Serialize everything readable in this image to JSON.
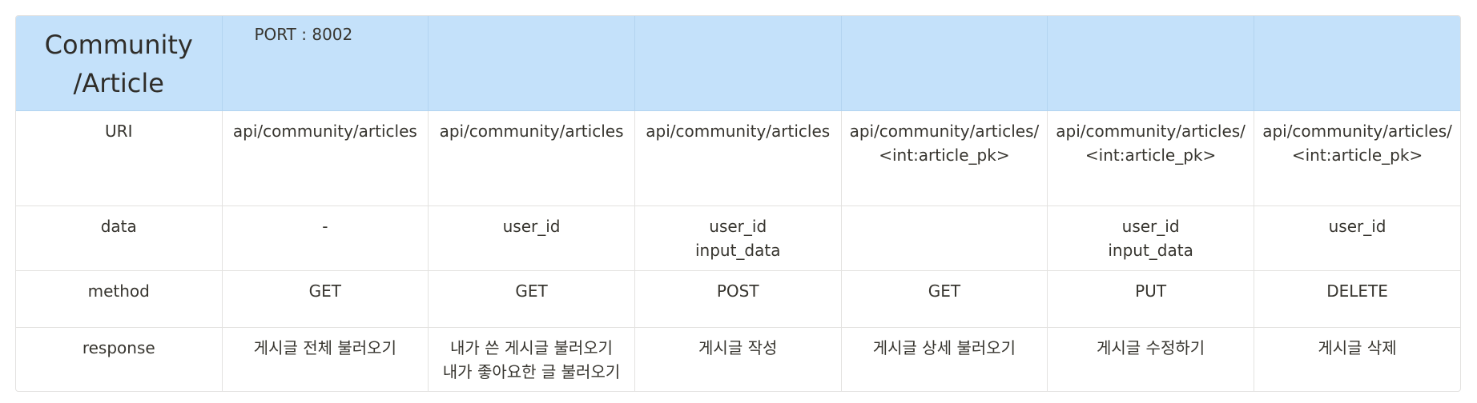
{
  "table": {
    "title_line1": "Community",
    "title_line2": "/Article",
    "port": "PORT : 8002",
    "rows": {
      "uri": {
        "label": "URI",
        "cells": [
          [
            "api/community/articles"
          ],
          [
            "api/community/articles"
          ],
          [
            "api/community/articles"
          ],
          [
            "api/community/articles/",
            "<int:article_pk>"
          ],
          [
            "api/community/articles/",
            "<int:article_pk>"
          ],
          [
            "api/community/articles/",
            "<int:article_pk>"
          ]
        ]
      },
      "data": {
        "label": "data",
        "cells": [
          [
            "-"
          ],
          [
            "user_id"
          ],
          [
            "user_id",
            "input_data"
          ],
          [],
          [
            "user_id",
            "input_data"
          ],
          [
            "user_id"
          ]
        ]
      },
      "method": {
        "label": "method",
        "cells": [
          [
            "GET"
          ],
          [
            "GET"
          ],
          [
            "POST"
          ],
          [
            "GET"
          ],
          [
            "PUT"
          ],
          [
            "DELETE"
          ]
        ]
      },
      "response": {
        "label": "response",
        "cells": [
          [
            "게시글 전체 불러오기"
          ],
          [
            "내가 쓴 게시글 불러오기",
            "내가 좋아요한 글 불러오기"
          ],
          [
            "게시글 작성"
          ],
          [
            "게시글 상세 불러오기"
          ],
          [
            "게시글 수정하기"
          ],
          [
            "게시글 삭제"
          ]
        ]
      }
    }
  },
  "colors": {
    "header_bg": "#c4e1fa",
    "border": "#e3e2e0",
    "text": "#37352f"
  }
}
